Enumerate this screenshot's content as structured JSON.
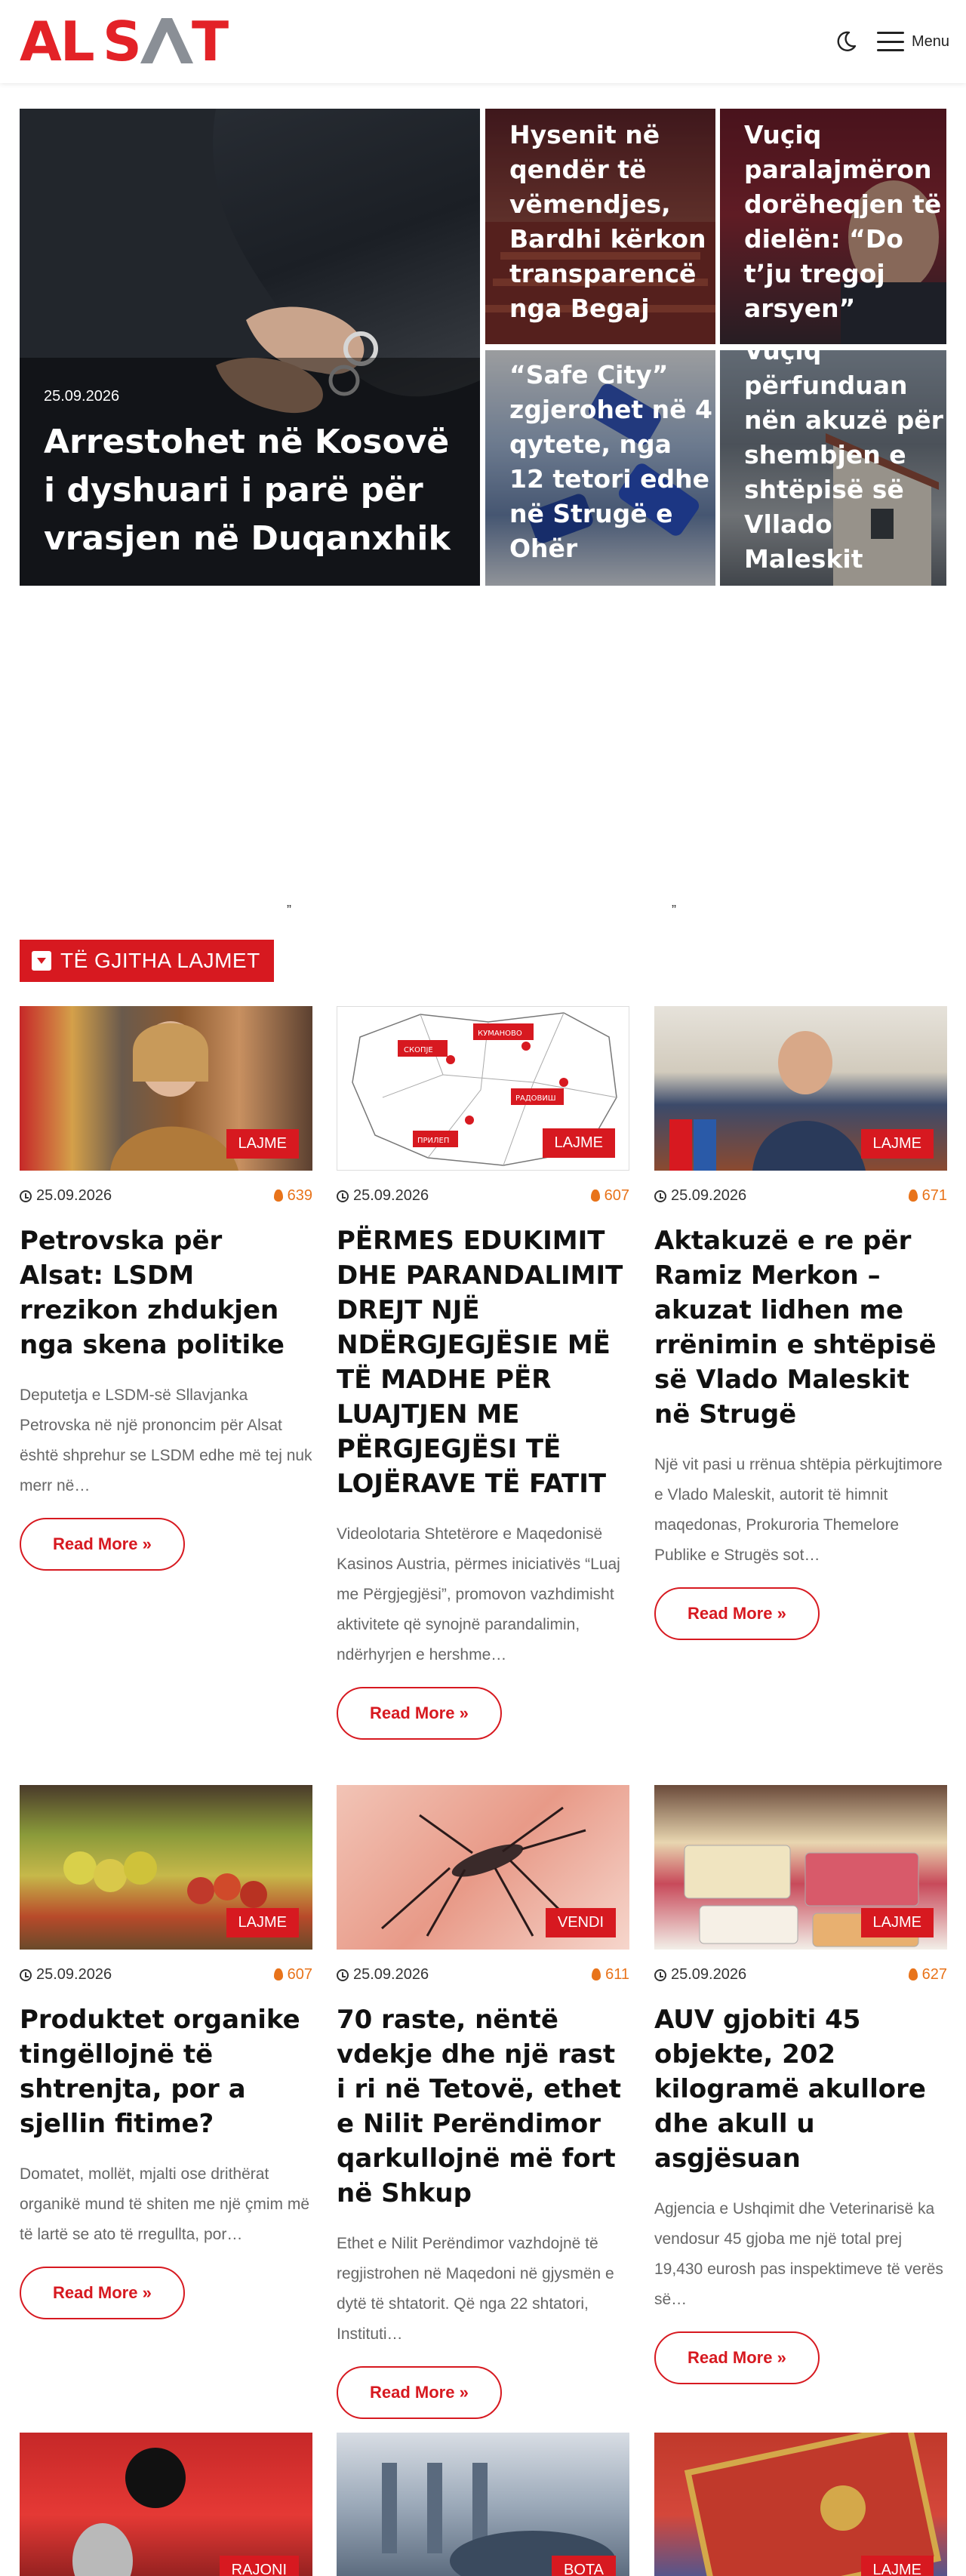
{
  "header": {
    "logo_text": "ALSAT",
    "menu_label": "Menu"
  },
  "hero": {
    "main": {
      "date": "25.09.2026",
      "title": "Arrestohet në Kosovë i dyshuari i parë për vrasjen në Duqanxhik"
    },
    "side": [
      {
        "title": "Hysenit në qendër të vëmendjes, Bardhi kërkon transparencë nga Begaj"
      },
      {
        "title": "Vuçiq paralajmëron dorëheqjen të dielën: “Do t’ju tregoj arsyen”"
      },
      {
        "title": "“Safe City” zgjerohet në 4 qytete, nga 12 tetori edhe në Strugë e Ohër"
      },
      {
        "title": "Vuçiq përfunduan nën akuzë për shembjen e shtëpisë së Vllado Maleskit"
      }
    ],
    "quote_marks": [
      "”",
      "”"
    ]
  },
  "section": {
    "title": "TË GJITHA LAJMET"
  },
  "articles": [
    {
      "category": "LAJME",
      "date": "25.09.2026",
      "views": "639",
      "title": "Petrovska për Alsat: LSDM rrezikon zhdukjen nga skena politike",
      "excerpt": "Deputetja e LSDM-së Sllavjanka Petrovska në një prononcim për Alsat është shprehur se LSDM edhe më tej nuk merr në…",
      "more": "Read More »"
    },
    {
      "category": "LAJME",
      "date": "25.09.2026",
      "views": "607",
      "title": "PËRMES EDUKIMIT DHE PARANDALIMIT DREJT NJË NDËRGJEGJËSIE MË TË MADHE PËR LUAJTJEN ME PËRGJEGJËSI TË LOJËRAVE TË FATIT",
      "excerpt": "Videolotaria Shtetërore e Maqedonisë Kasinos Austria, përmes iniciativës “Luaj me Përgjegjësi”, promovon vazhdimisht aktivitete që synojnë parandalimin, ndërhyrjen e hershme…",
      "more": "Read More »",
      "map_labels": [
        "КУМАНОВО",
        "СКОПЈЕ",
        "РАДОВИШ",
        "ПРИЛЕП"
      ]
    },
    {
      "category": "LAJME",
      "date": "25.09.2026",
      "views": "671",
      "title": "Aktakuzë e re për Ramiz Merkon – akuzat lidhen me rrënimin e shtëpisë së Vlado Maleskit në Strugë",
      "excerpt": "Një vit pasi u rrënua shtëpia përkujtimore e Vlado Maleskit, autorit të himnit maqedonas, Prokuroria Themelore Publike e Strugës sot…",
      "more": "Read More »"
    },
    {
      "category": "LAJME",
      "date": "25.09.2026",
      "views": "607",
      "title": "Produktet organike tingëllojnë të shtrenjta, por a sjellin fitime?",
      "excerpt": "Domatet, mollët, mjalti ose drithërat organikë mund të shiten me një çmim më të lartë se ato të rregullta, por…",
      "more": "Read More »"
    },
    {
      "category": "VENDI",
      "date": "25.09.2026",
      "views": "611",
      "title": "70 raste, nëntë vdekje dhe një rast i ri në Tetovë, ethet e Nilit Perëndimor qarkullojnë më fort në Shkup",
      "excerpt": "Ethet e Nilit Perëndimor vazhdojnë të regjistrohen në Maqedoni në gjysmën e dytë të shtatorit. Që nga 22 shtatori, Instituti…",
      "more": "Read More »"
    },
    {
      "category": "LAJME",
      "date": "25.09.2026",
      "views": "627",
      "title": "AUV gjobiti 45 objekte, 202 kilogramë akullore dhe akull u asgjësuan",
      "excerpt": "Agjencia e Ushqimit dhe Veterinarisë ka vendosur 45 gjoba me një total prej 19,430 eurosh pas inspektimeve të verës së…",
      "more": "Read More »"
    },
    {
      "category": "RAJONI"
    },
    {
      "category": "BOTA"
    },
    {
      "category": "LAJME"
    }
  ],
  "colors": {
    "brand_red": "#d71920",
    "views_orange": "#e8731a",
    "excerpt_gray": "#666666"
  },
  "icons": [
    "moon-icon",
    "menu-icon",
    "clock-icon",
    "flame-icon",
    "chevron-down-icon"
  ]
}
